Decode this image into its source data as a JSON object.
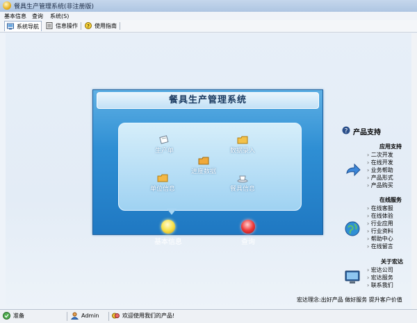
{
  "window": {
    "title": "餐具生产管理系统(非注册版)"
  },
  "menu": {
    "items": [
      "基本信息",
      "查询",
      "系统(S)"
    ]
  },
  "toolbar": {
    "items": [
      "系统导航",
      "信息操作",
      "使用指南"
    ]
  },
  "panel": {
    "title": "餐具生产管理系统",
    "buttons": [
      "生产单",
      "数据录入",
      "进度数据",
      "单位信息",
      "餐具信息"
    ],
    "big_buttons": [
      "基本信息",
      "查询"
    ]
  },
  "sidebar": {
    "title": "产品支持",
    "sections": [
      {
        "title": "应用支持",
        "items": [
          "二次开发",
          "在线开发",
          "业务帮助",
          "产品形式",
          "产品购买"
        ]
      },
      {
        "title": "在线服务",
        "items": [
          "在线客服",
          "在线体验",
          "行业应用",
          "行业资料",
          "帮助中心",
          "在线留言"
        ]
      },
      {
        "title": "关于宏达",
        "items": [
          "宏达公司",
          "宏达服务",
          "联系我们"
        ]
      }
    ],
    "slogan": "宏达理念:出好产品  做好服务  提升客户价值"
  },
  "status": {
    "ready": "准备",
    "user": "Admin",
    "welcome": "欢迎使用我们的产品!"
  },
  "colors": {
    "panel": "#2f8fd4",
    "accent": "#1f78c2"
  },
  "icons": [
    "app-icon",
    "navigator-icon",
    "info-operation-icon",
    "help-icon",
    "question-icon",
    "arrow-icon",
    "globe-icon",
    "monitor-icon",
    "status-ready-icon",
    "user-icon",
    "welcome-icon"
  ]
}
